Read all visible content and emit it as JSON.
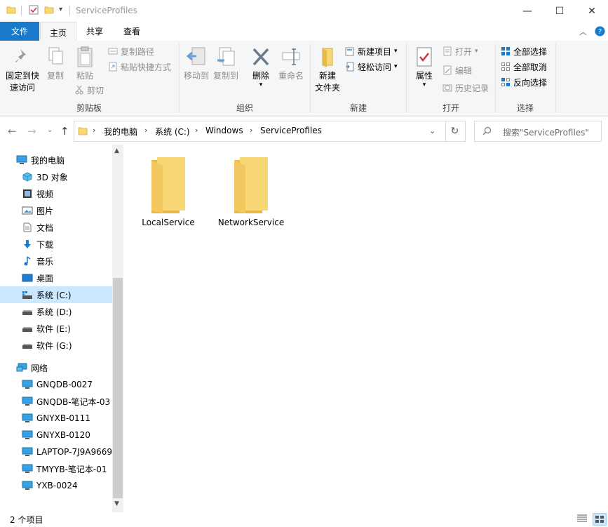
{
  "window": {
    "title": "ServiceProfiles",
    "minimize": "—",
    "maximize": "☐",
    "close": "✕"
  },
  "tabs": {
    "file": "文件",
    "home": "主页",
    "share": "共享",
    "view": "查看"
  },
  "ribbon": {
    "clipboard": {
      "group_label": "剪贴板",
      "pin": "固定到快速访问",
      "pin_line1": "固定到快",
      "pin_line2": "速访问",
      "copy": "复制",
      "paste": "粘贴",
      "copy_path": "复制路径",
      "paste_shortcut": "粘贴快捷方式",
      "cut": "剪切"
    },
    "organize": {
      "group_label": "组织",
      "move_to": "移动到",
      "copy_to": "复制到",
      "delete": "删除",
      "rename": "重命名"
    },
    "new": {
      "group_label": "新建",
      "new_folder_line1": "新建",
      "new_folder_line2": "文件夹",
      "new_item": "新建项目",
      "easy_access": "轻松访问"
    },
    "open": {
      "group_label": "打开",
      "properties": "属性",
      "open": "打开",
      "edit": "编辑",
      "history": "历史记录"
    },
    "select": {
      "group_label": "选择",
      "select_all": "全部选择",
      "select_none": "全部取消",
      "invert": "反向选择"
    }
  },
  "address": {
    "crumbs": [
      "我的电脑",
      "系统 (C:)",
      "Windows",
      "ServiceProfiles"
    ],
    "search_placeholder": "搜索\"ServiceProfiles\""
  },
  "nav": {
    "items": [
      {
        "label": "我的电脑",
        "icon": "computer-icon"
      },
      {
        "label": "3D 对象",
        "icon": "3d-objects-icon"
      },
      {
        "label": "视频",
        "icon": "video-icon"
      },
      {
        "label": "图片",
        "icon": "pictures-icon"
      },
      {
        "label": "文档",
        "icon": "documents-icon"
      },
      {
        "label": "下载",
        "icon": "download-icon"
      },
      {
        "label": "音乐",
        "icon": "music-icon"
      },
      {
        "label": "桌面",
        "icon": "desktop-icon"
      },
      {
        "label": "系统 (C:)",
        "icon": "drive-icon"
      },
      {
        "label": "系统 (D:)",
        "icon": "drive-icon"
      },
      {
        "label": "软件 (E:)",
        "icon": "drive-icon"
      },
      {
        "label": "软件 (G:)",
        "icon": "drive-icon"
      },
      {
        "label": "网络",
        "icon": "network-icon"
      },
      {
        "label": "GNQDB-0027",
        "icon": "network-computer-icon"
      },
      {
        "label": "GNQDB-笔记本-03",
        "icon": "network-computer-icon"
      },
      {
        "label": "GNYXB-0111",
        "icon": "network-computer-icon"
      },
      {
        "label": "GNYXB-0120",
        "icon": "network-computer-icon"
      },
      {
        "label": "LAPTOP-7J9A9669",
        "icon": "network-computer-icon"
      },
      {
        "label": "TMYYB-笔记本-01",
        "icon": "network-computer-icon"
      },
      {
        "label": "YXB-0024",
        "icon": "network-computer-icon"
      }
    ]
  },
  "content": {
    "folders": [
      "LocalService",
      "NetworkService"
    ]
  },
  "status": {
    "count": "2 个项目"
  },
  "colors": {
    "file_tab": "#1979ca",
    "selected_nav": "#cce8ff",
    "folder": "#f8d775"
  }
}
